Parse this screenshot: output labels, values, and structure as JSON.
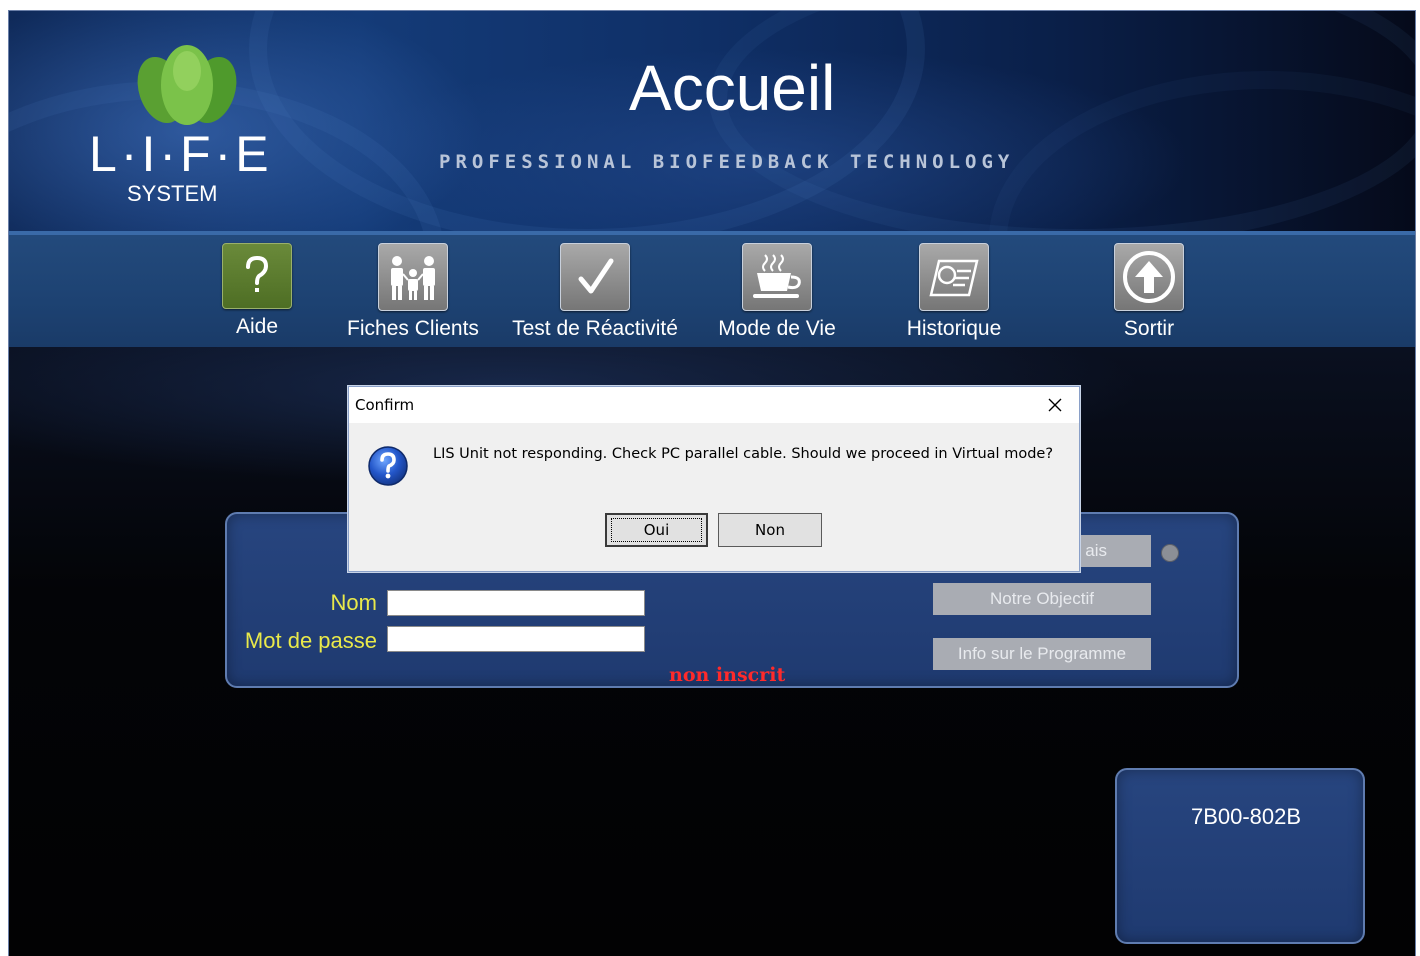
{
  "header": {
    "logo_text": "L·I·F·E",
    "logo_subtext": "SYSTEM",
    "page_title": "Accueil",
    "tagline": "PROFESSIONAL BIOFEEDBACK TECHNOLOGY"
  },
  "toolbar": {
    "items": [
      {
        "label": "Aide",
        "icon": "help-question-icon"
      },
      {
        "label": "Fiches Clients",
        "icon": "family-people-icon"
      },
      {
        "label": "Test de Réactivité",
        "icon": "checkmark-icon"
      },
      {
        "label": "Mode de Vie",
        "icon": "coffee-cup-icon"
      },
      {
        "label": "Historique",
        "icon": "history-document-icon"
      },
      {
        "label": "Sortir",
        "icon": "exit-arrow-up-icon"
      }
    ]
  },
  "login": {
    "name_label": "Nom",
    "name_value": "",
    "password_label": "Mot de passe",
    "password_value": "",
    "status": "non inscrit",
    "btn_language_partial": "ais",
    "btn_objective": "Notre Objectif",
    "btn_program_info": "Info sur le Programme"
  },
  "serial": {
    "code": "7B00-802B"
  },
  "dialog": {
    "title": "Confirm",
    "message": "LIS Unit not responding. Check PC parallel cable. Should we proceed in Virtual mode?",
    "icon": "question-icon",
    "yes_label": "Oui",
    "no_label": "Non"
  },
  "colors": {
    "header_blue": "#143b78",
    "toolbar_blue": "#1d4272",
    "panel_blue": "#1f3a70",
    "label_yellow": "#e9e94a",
    "status_red": "#ff2a2a",
    "leaf_green": "#7bc24a"
  }
}
